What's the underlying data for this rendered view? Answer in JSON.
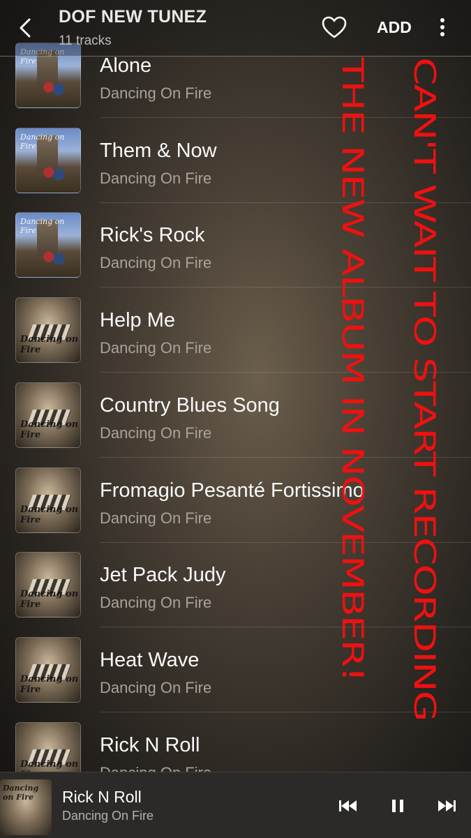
{
  "header": {
    "title": "DOF NEW TUNEZ",
    "subtitle": "11 tracks",
    "add_label": "ADD"
  },
  "tracks": [
    {
      "title": "Alone",
      "artist": "Dancing On Fire",
      "art": "parliament"
    },
    {
      "title": "Them & Now",
      "artist": "Dancing On Fire",
      "art": "parliament"
    },
    {
      "title": "Rick's Rock",
      "artist": "Dancing On Fire",
      "art": "parliament"
    },
    {
      "title": "Help Me",
      "artist": "Dancing On Fire",
      "art": "piano"
    },
    {
      "title": "Country Blues Song",
      "artist": "Dancing On Fire",
      "art": "piano"
    },
    {
      "title": "Fromagio Pesanté Fortissimo",
      "artist": "Dancing On Fire",
      "art": "piano"
    },
    {
      "title": "Jet Pack Judy",
      "artist": "Dancing On Fire",
      "art": "piano"
    },
    {
      "title": "Heat Wave",
      "artist": "Dancing On Fire",
      "art": "piano"
    },
    {
      "title": "Rick N Roll",
      "artist": "Dancing On Fire",
      "art": "piano"
    }
  ],
  "album_art_text": "Dancing on Fire",
  "overlay": {
    "line1": "CAN'T WAIT TO START RECORDING",
    "line2": "THE NEW ALBUM IN NOVEMBER!",
    "color": "#ee1111"
  },
  "now_playing": {
    "title": "Rick N Roll",
    "artist": "Dancing On Fire",
    "state": "playing"
  },
  "icons": {
    "back": "back-arrow-icon",
    "favorite": "heart-icon",
    "more": "more-vertical-icon",
    "prev": "skip-previous-icon",
    "pause": "pause-icon",
    "next": "skip-next-icon"
  }
}
